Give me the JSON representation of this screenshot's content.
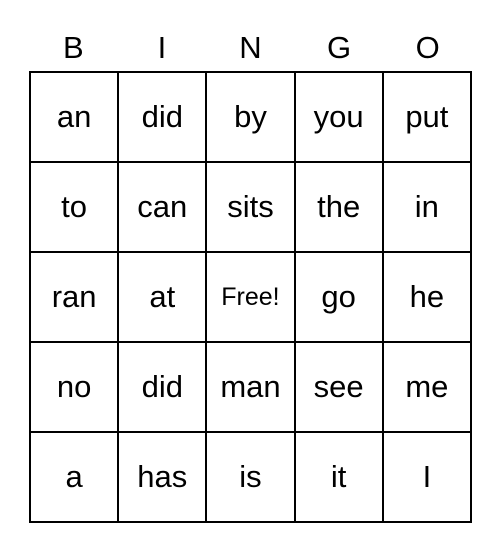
{
  "header": [
    "B",
    "I",
    "N",
    "G",
    "O"
  ],
  "rows": [
    [
      "an",
      "did",
      "by",
      "you",
      "put"
    ],
    [
      "to",
      "can",
      "sits",
      "the",
      "in"
    ],
    [
      "ran",
      "at",
      "Free!",
      "go",
      "he"
    ],
    [
      "no",
      "did",
      "man",
      "see",
      "me"
    ],
    [
      "a",
      "has",
      "is",
      "it",
      "I"
    ]
  ]
}
